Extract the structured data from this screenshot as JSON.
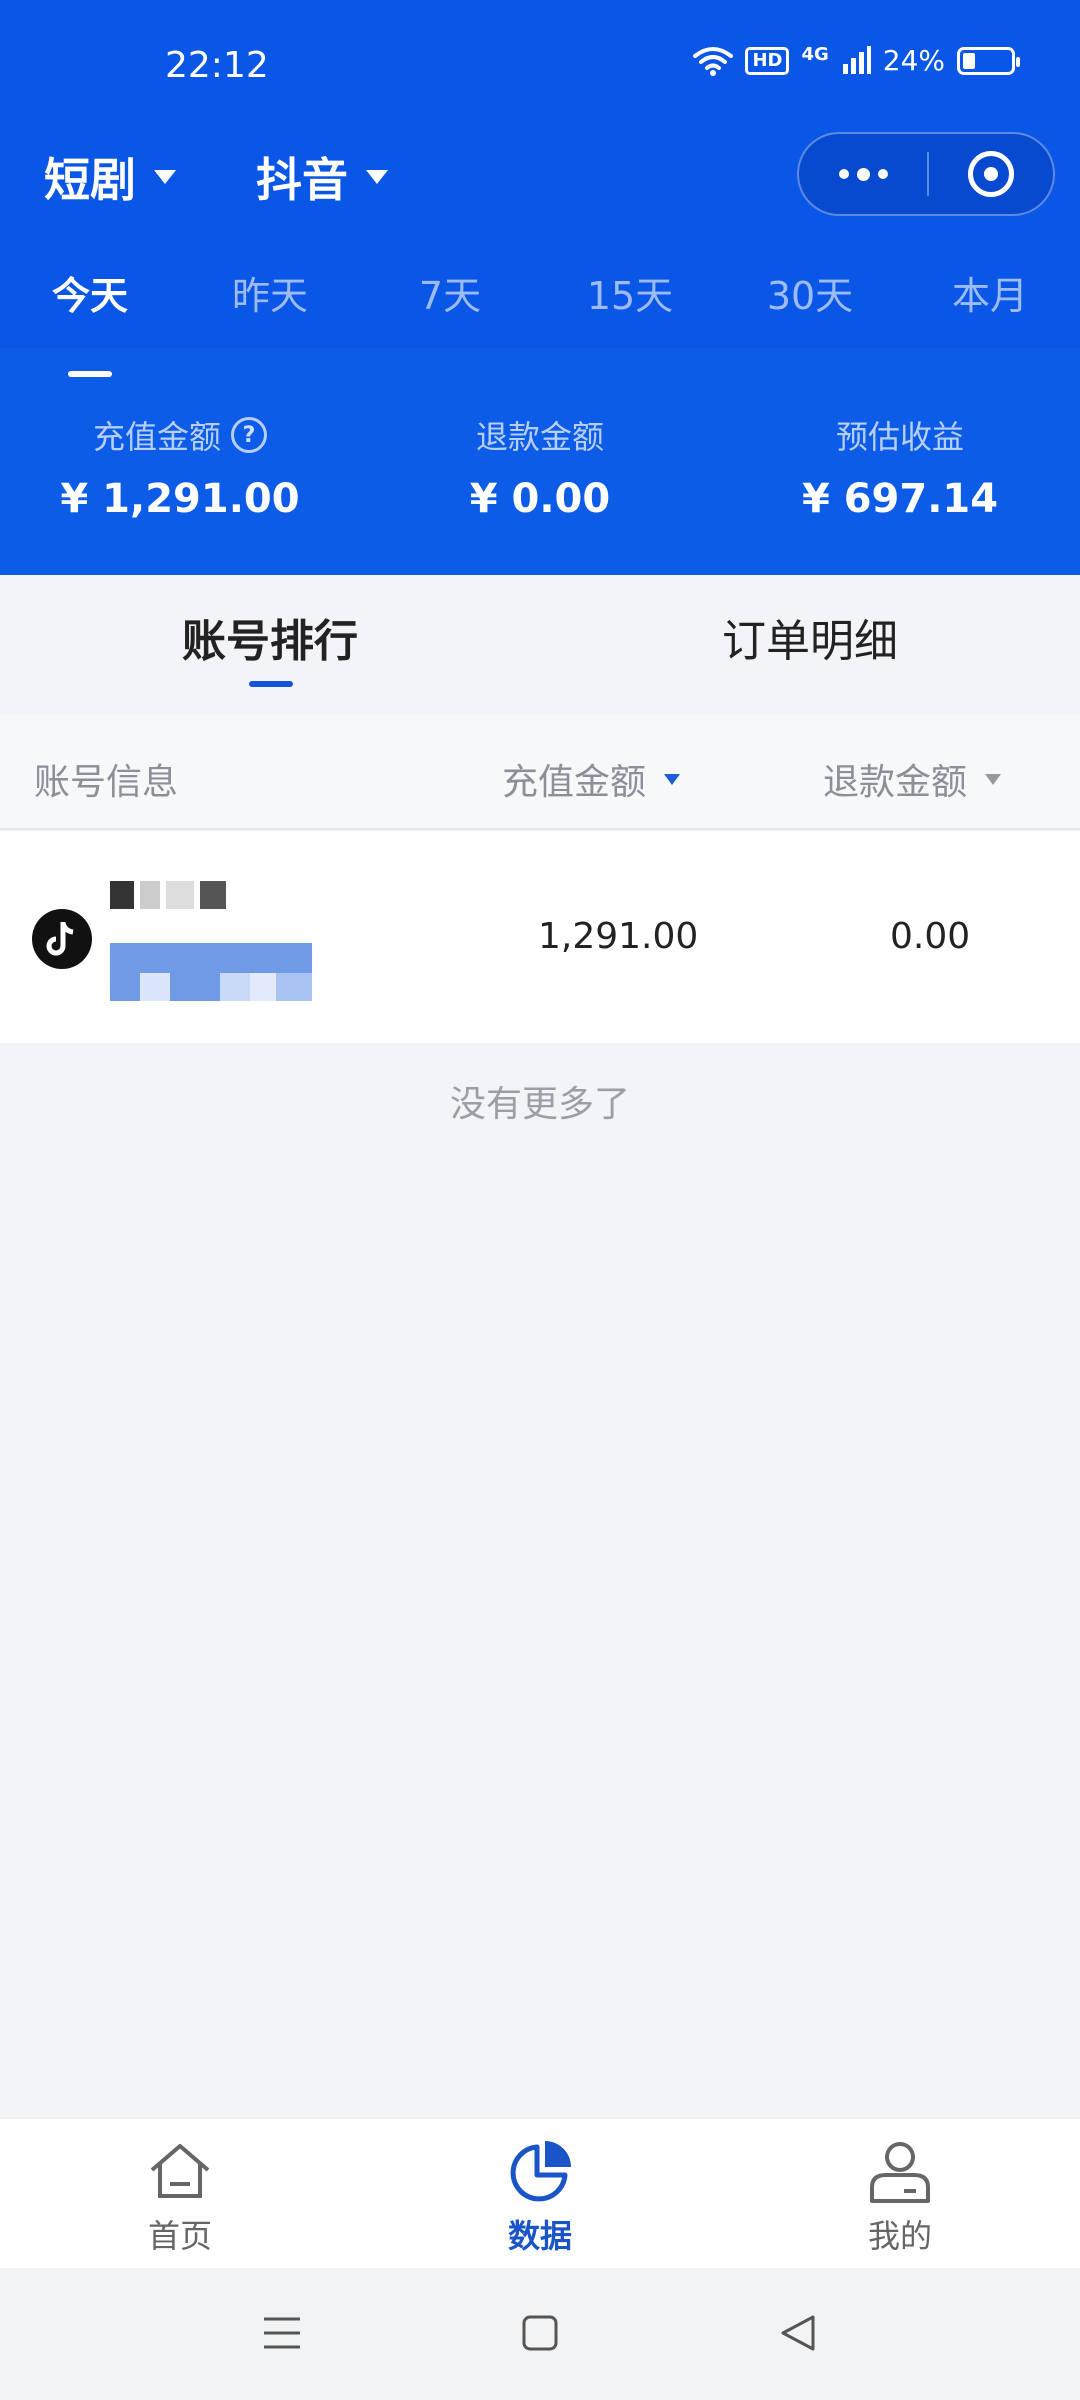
{
  "status": {
    "time": "22:12",
    "hd": "HD",
    "network": "4G",
    "battery": "24%"
  },
  "nav": {
    "category": "短剧",
    "platform": "抖音"
  },
  "date_tabs": [
    {
      "label": "今天",
      "active": true
    },
    {
      "label": "昨天",
      "active": false
    },
    {
      "label": "7天",
      "active": false
    },
    {
      "label": "15天",
      "active": false
    },
    {
      "label": "30天",
      "active": false
    },
    {
      "label": "本月",
      "active": false
    }
  ],
  "summary": {
    "recharge": {
      "label": "充值金额",
      "value": "¥ 1,291.00"
    },
    "refund": {
      "label": "退款金额",
      "value": "¥ 0.00"
    },
    "earnings": {
      "label": "预估收益",
      "value": "¥ 697.14"
    }
  },
  "segments": {
    "ranking": "账号排行",
    "orders": "订单明细"
  },
  "table": {
    "headers": {
      "account": "账号信息",
      "recharge": "充值金额",
      "refund": "退款金额"
    },
    "rows": [
      {
        "platform_icon": "tiktok-icon",
        "recharge": "1,291.00",
        "refund": "0.00"
      }
    ],
    "no_more": "没有更多了"
  },
  "bottom_nav": {
    "home": "首页",
    "data": "数据",
    "mine": "我的"
  },
  "colors": {
    "primary_blue": "#0a56e6",
    "active_nav": "#1a55c8"
  }
}
